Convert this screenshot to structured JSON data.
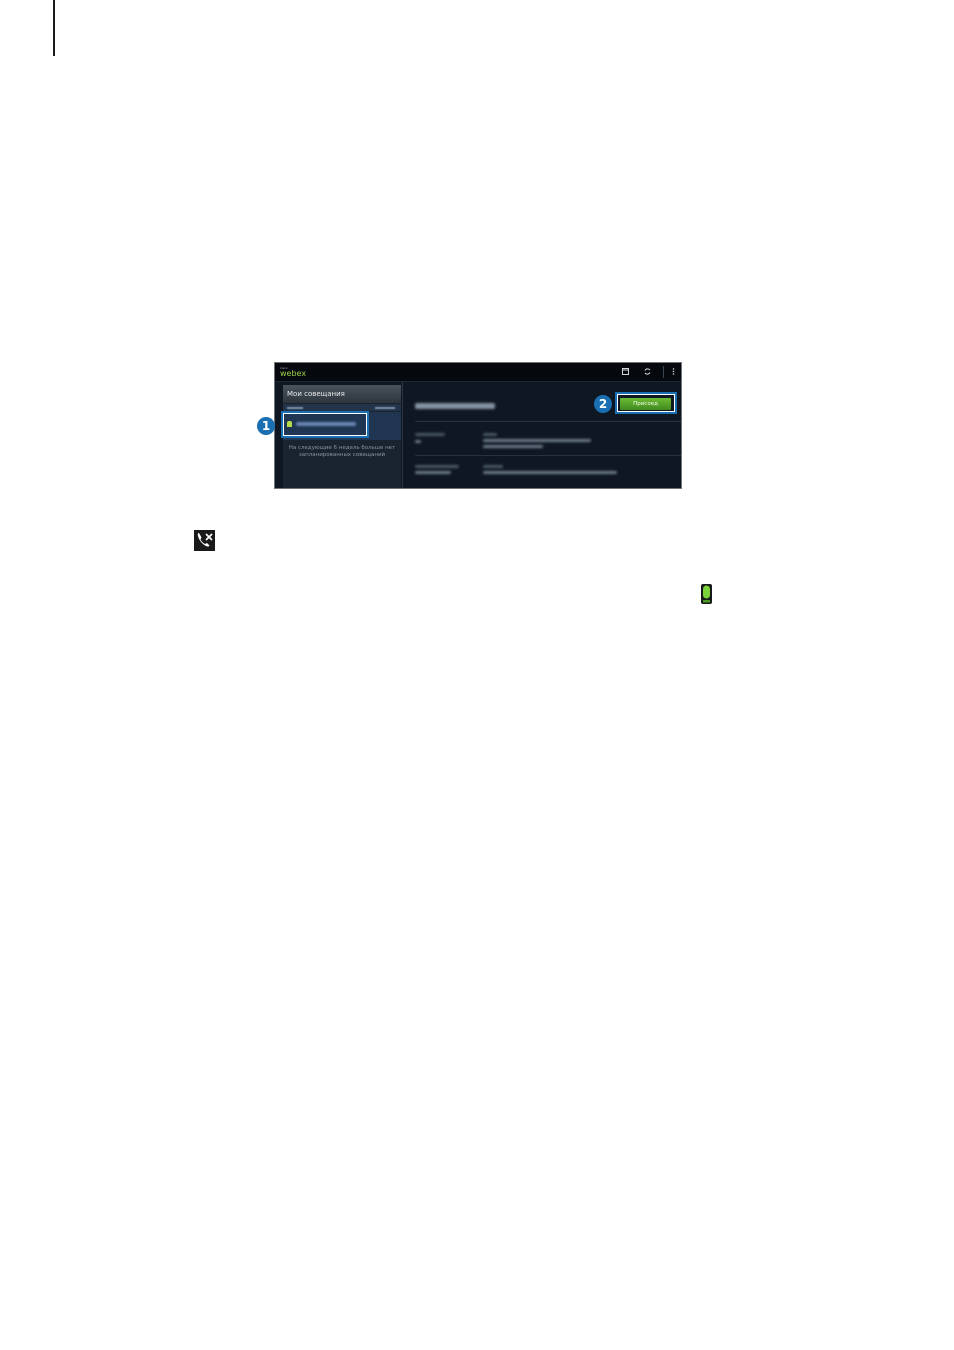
{
  "app": {
    "brand_small": "cisco",
    "brand_name": "webex"
  },
  "sidebar": {
    "title": "Мои совещания",
    "empty_note": "На следующие 6 недель больше нет запланированных совещаний"
  },
  "main": {
    "join_label": "Присоед"
  },
  "callouts": [
    "1",
    "2"
  ],
  "icons": {
    "actionbar": [
      "calendar-icon",
      "refresh-icon",
      "overflow-menu-icon"
    ],
    "inline": [
      "end-call-icon",
      "microphone-icon"
    ]
  },
  "colors": {
    "accent_green": "#9fd14f",
    "callout_blue": "#1a6fb3",
    "app_background": "#0f1722"
  }
}
